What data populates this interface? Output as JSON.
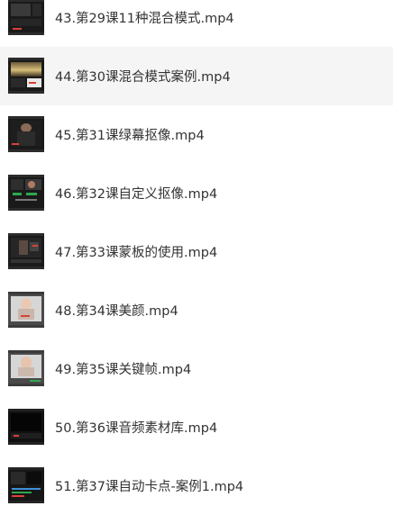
{
  "files": [
    {
      "name": "43.第29课11种混合模式.mp4",
      "thumb": "editor-dark-1",
      "selected": false
    },
    {
      "name": "44.第30课混合模式案例.mp4",
      "thumb": "editor-sky",
      "selected": true
    },
    {
      "name": "45.第31课绿幕抠像.mp4",
      "thumb": "editor-person-dark",
      "selected": false
    },
    {
      "name": "46.第32课自定义抠像.mp4",
      "thumb": "editor-green-keys",
      "selected": false
    },
    {
      "name": "47.第33课蒙板的使用.mp4",
      "thumb": "editor-person-stage",
      "selected": false
    },
    {
      "name": "48.第34课美颜.mp4",
      "thumb": "editor-face-light",
      "selected": false
    },
    {
      "name": "49.第35课关键帧.mp4",
      "thumb": "editor-face-keyframe",
      "selected": false
    },
    {
      "name": "50.第36课音频素材库.mp4",
      "thumb": "editor-black",
      "selected": false
    },
    {
      "name": "51.第37课自动卡点-案例1.mp4",
      "thumb": "editor-timeline",
      "selected": false
    }
  ],
  "colors": {
    "text": "#333333",
    "selected_row": "#f5f5f5",
    "accent_red": "#d9413a",
    "accent_green": "#2ea84e"
  }
}
